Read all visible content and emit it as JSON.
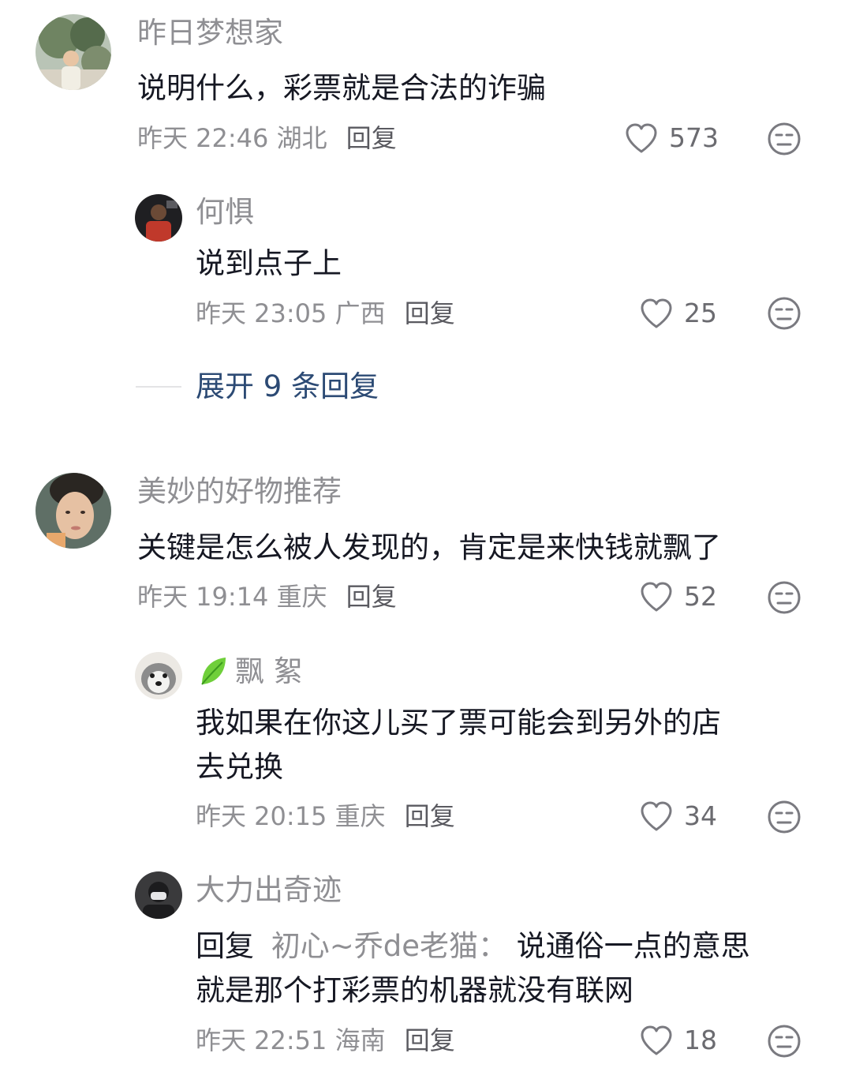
{
  "comments": [
    {
      "name": "昨日梦想家",
      "text": "说明什么，彩票就是合法的诈骗",
      "time": "昨天 22:46",
      "location": "湖北",
      "reply_label": "回复",
      "likes": "573",
      "replies": [
        {
          "name": "何惧",
          "text": "说到点子上",
          "time": "昨天 23:05",
          "location": "广西",
          "reply_label": "回复",
          "likes": "25"
        }
      ],
      "expand_label": "展开 9 条回复"
    },
    {
      "name": "美妙的好物推荐",
      "text": "关键是怎么被人发现的，肯定是来快钱就飘了",
      "time": "昨天 19:14",
      "location": "重庆",
      "reply_label": "回复",
      "likes": "52",
      "replies": [
        {
          "name": "飘 絮",
          "name_icon": "leaf-icon",
          "text_line1": "我如果在你这儿买了票可能会到另外的店",
          "text_line2": "去兑换",
          "time": "昨天 20:15",
          "location": "重庆",
          "reply_label": "回复",
          "likes": "34"
        },
        {
          "name": "大力出奇迹",
          "reply_prefix": "回复",
          "reply_target": "初心~乔de老猫：",
          "text_line1": "说通俗一点的意思",
          "text_line2": "就是那个打彩票的机器就没有联网",
          "time": "昨天 22:51",
          "location": "海南",
          "reply_label": "回复",
          "likes": "18"
        }
      ]
    }
  ],
  "icons": {
    "like": "heart-outline-icon",
    "dislike": "unhappy-face-icon"
  },
  "colors": {
    "name": "#8f8f93",
    "text": "#161823",
    "expand": "#2c4a74"
  }
}
